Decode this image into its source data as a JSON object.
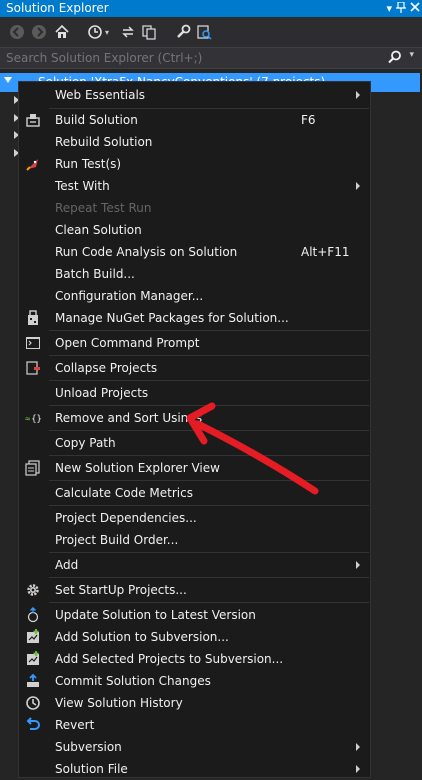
{
  "window": {
    "title": "Solution Explorer"
  },
  "search": {
    "placeholder": "Search Solution Explorer (Ctrl+;)"
  },
  "tree": {
    "selected_label": "Solution 'XtraFx.NancyConventions' (7 projects)"
  },
  "menu": {
    "items": [
      {
        "label": "Web Essentials",
        "submenu": true
      },
      {
        "label": "Build Solution",
        "shortcut": "F6",
        "icon": "build-icon"
      },
      {
        "label": "Rebuild Solution"
      },
      {
        "label": "Run Test(s)",
        "icon": "rocket-icon"
      },
      {
        "label": "Test With",
        "submenu": true
      },
      {
        "label": "Repeat Test Run",
        "disabled": true
      },
      {
        "label": "Clean Solution"
      },
      {
        "label": "Run Code Analysis on Solution",
        "shortcut": "Alt+F11"
      },
      {
        "label": "Batch Build..."
      },
      {
        "label": "Configuration Manager..."
      },
      {
        "label": "Manage NuGet Packages for Solution...",
        "icon": "nuget-icon"
      },
      {
        "label": "Open Command Prompt",
        "icon": "command-prompt-icon"
      },
      {
        "label": "Collapse Projects",
        "icon": "collapse-icon"
      },
      {
        "label": "Unload Projects"
      },
      {
        "label": "Remove and Sort Usings",
        "icon": "sort-usings-icon"
      },
      {
        "label": "Copy Path"
      },
      {
        "label": "New Solution Explorer View",
        "icon": "new-view-icon"
      },
      {
        "label": "Calculate Code Metrics"
      },
      {
        "label": "Project Dependencies..."
      },
      {
        "label": "Project Build Order..."
      },
      {
        "label": "Add",
        "submenu": true
      },
      {
        "label": "Set StartUp Projects...",
        "icon": "gear-icon"
      },
      {
        "label": "Update Solution to Latest Version",
        "icon": "update-icon"
      },
      {
        "label": "Add Solution to Subversion...",
        "icon": "add-svn-icon"
      },
      {
        "label": "Add Selected Projects to Subversion...",
        "icon": "add-svn-projects-icon"
      },
      {
        "label": "Commit Solution Changes",
        "icon": "commit-icon"
      },
      {
        "label": "View Solution History",
        "icon": "history-icon"
      },
      {
        "label": "Revert",
        "icon": "revert-icon"
      },
      {
        "label": "Subversion",
        "submenu": true
      },
      {
        "label": "Solution File",
        "submenu": true
      }
    ]
  },
  "annotation": {
    "icon": "red-arrow-icon",
    "color": "#e51c23"
  },
  "colors": {
    "accent": "#007acc",
    "selection": "#3399ff",
    "menu_bg": "#1b1b1c"
  }
}
